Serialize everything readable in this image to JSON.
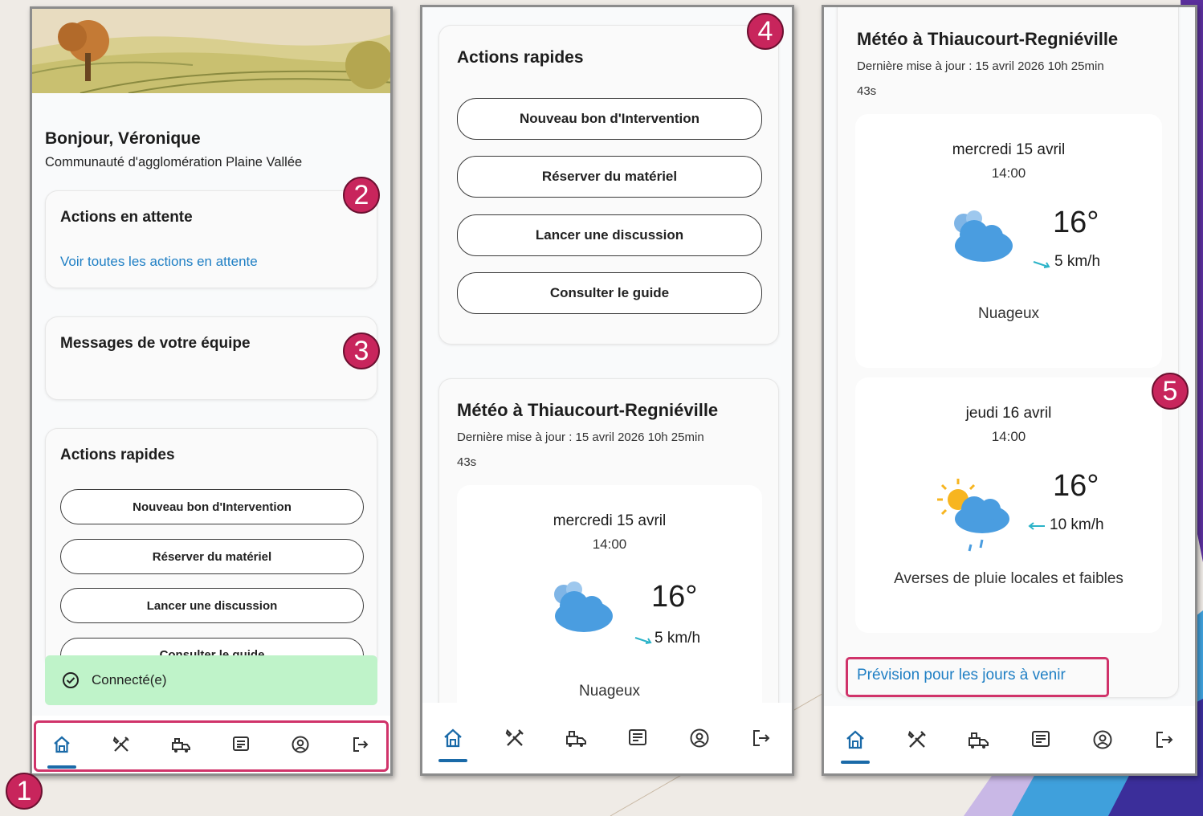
{
  "screen1": {
    "greeting": "Bonjour, Véronique",
    "organization": "Communauté d'agglomération Plaine Vallée",
    "pending": {
      "title": "Actions en attente",
      "link": "Voir toutes les actions en attente"
    },
    "messages": {
      "title": "Messages de votre équipe"
    },
    "quick": {
      "title": "Actions rapides",
      "buttons": [
        "Nouveau bon d'Intervention",
        "Réserver du matériel",
        "Lancer une discussion",
        "Consulter le guide"
      ]
    },
    "toast": "Connecté(e)"
  },
  "screen2": {
    "quick": {
      "title": "Actions rapides",
      "buttons": [
        "Nouveau bon d'Intervention",
        "Réserver du matériel",
        "Lancer une discussion",
        "Consulter le guide"
      ]
    },
    "weather": {
      "title": "Météo à Thiaucourt-Regniéville",
      "updated_line1": "Dernière mise à jour : 15 avril 2026 10h 25min",
      "updated_line2": "43s",
      "day": {
        "date": "mercredi 15 avril",
        "time": "14:00",
        "temp": "16°",
        "wind": "5 km/h",
        "condition": "Nuageux"
      }
    }
  },
  "screen3": {
    "weather": {
      "title": "Météo à Thiaucourt-Regniéville",
      "updated_line1": "Dernière mise à jour : 15 avril 2026 10h 25min",
      "updated_line2": "43s",
      "days": [
        {
          "date": "mercredi 15 avril",
          "time": "14:00",
          "temp": "16°",
          "wind": "5 km/h",
          "condition": "Nuageux"
        },
        {
          "date": "jeudi 16 avril",
          "time": "14:00",
          "temp": "16°",
          "wind": "10 km/h",
          "condition": "Averses de pluie locales et faibles"
        }
      ],
      "forecast_link": "Prévision pour les jours à venir"
    }
  },
  "nav_icons": [
    "home-icon",
    "tools-icon",
    "vehicles-icon",
    "messages-icon",
    "profile-icon",
    "logout-icon"
  ],
  "badges": [
    "1",
    "2",
    "3",
    "4",
    "5"
  ],
  "colors": {
    "accent_blue": "#1a6aa8",
    "link": "#1f7fc4",
    "highlight": "#d0336a",
    "toast_bg": "#bff3c9",
    "badge": "#c8255c"
  }
}
